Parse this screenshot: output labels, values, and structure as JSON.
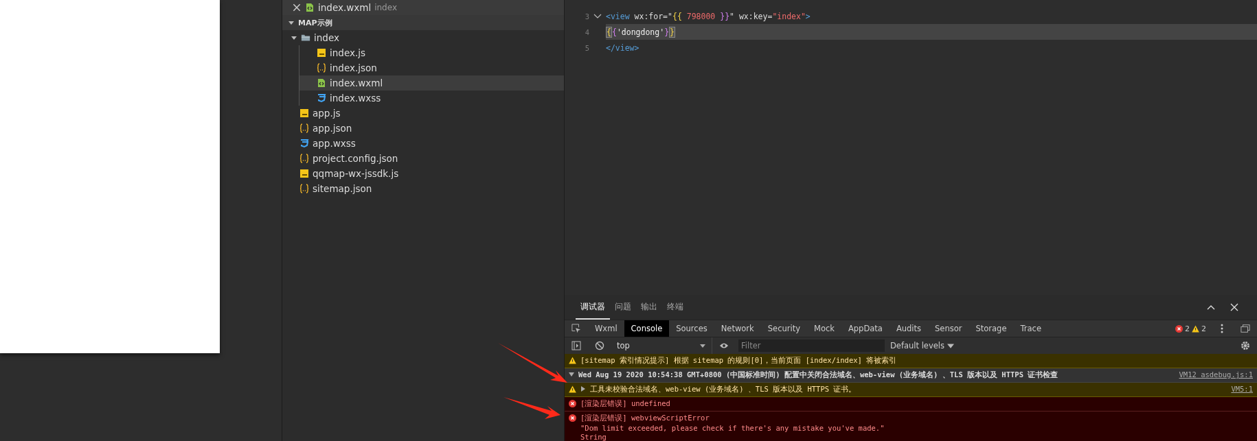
{
  "explorer": {
    "open_editors": [
      {
        "label": "index.wxml",
        "hint": "index",
        "kind": "wxml"
      }
    ],
    "project": {
      "label": "MAP示例",
      "expanded": true
    },
    "tree": [
      {
        "label": "index",
        "kind": "folder",
        "expanded": true,
        "selected": false,
        "children": [
          {
            "label": "index.js",
            "kind": "js",
            "selected": false
          },
          {
            "label": "index.json",
            "kind": "json",
            "selected": false
          },
          {
            "label": "index.wxml",
            "kind": "wxml",
            "selected": true
          },
          {
            "label": "index.wxss",
            "kind": "wxss",
            "selected": false
          }
        ]
      },
      {
        "label": "app.js",
        "kind": "js",
        "selected": false
      },
      {
        "label": "app.json",
        "kind": "json",
        "selected": false
      },
      {
        "label": "app.wxss",
        "kind": "wxss",
        "selected": false
      },
      {
        "label": "project.config.json",
        "kind": "json",
        "selected": false
      },
      {
        "label": "qqmap-wx-jssdk.js",
        "kind": "js",
        "selected": false
      },
      {
        "label": "sitemap.json",
        "kind": "json",
        "selected": false
      }
    ]
  },
  "editor": {
    "lines": [
      {
        "number": "3",
        "foldable": true,
        "current": false,
        "tokens": [
          {
            "text": "<view",
            "kind": "tag"
          },
          {
            "text": " wx:for=",
            "kind": "attr"
          },
          {
            "text": "\"",
            "kind": "attr"
          },
          {
            "text": "{{",
            "kind": "brace1"
          },
          {
            "text": " 798000 ",
            "kind": "number"
          },
          {
            "text": "}}",
            "kind": "brace2"
          },
          {
            "text": "\"",
            "kind": "attr"
          },
          {
            "text": " wx:key=",
            "kind": "attr"
          },
          {
            "text": "\"index\"",
            "kind": "string"
          },
          {
            "text": ">",
            "kind": "tag"
          }
        ]
      },
      {
        "number": "4",
        "foldable": false,
        "current": true,
        "tokens": [
          {
            "text": "{",
            "kind": "match"
          },
          {
            "text": "{",
            "kind": "brace2"
          },
          {
            "text": "'dongdong'",
            "kind": "plain"
          },
          {
            "text": "}",
            "kind": "brace2"
          },
          {
            "text": "}",
            "kind": "match"
          }
        ]
      },
      {
        "number": "5",
        "foldable": false,
        "current": false,
        "tokens": [
          {
            "text": "</view>",
            "kind": "tag"
          }
        ]
      }
    ]
  },
  "debugger": {
    "panel_tabs": [
      {
        "label": "调试器",
        "selected": true
      },
      {
        "label": "问题",
        "selected": false
      },
      {
        "label": "输出",
        "selected": false
      },
      {
        "label": "终端",
        "selected": false
      }
    ],
    "tools": [
      {
        "label": "Wxml",
        "selected": false
      },
      {
        "label": "Console",
        "selected": true
      },
      {
        "label": "Sources",
        "selected": false
      },
      {
        "label": "Network",
        "selected": false
      },
      {
        "label": "Security",
        "selected": false
      },
      {
        "label": "Mock",
        "selected": false
      },
      {
        "label": "AppData",
        "selected": false
      },
      {
        "label": "Audits",
        "selected": false
      },
      {
        "label": "Sensor",
        "selected": false
      },
      {
        "label": "Storage",
        "selected": false
      },
      {
        "label": "Trace",
        "selected": false
      }
    ],
    "error_count": "2",
    "warning_count": "2",
    "context": "top",
    "filter_placeholder": "Filter",
    "levels": "Default levels",
    "messages": [
      {
        "kind": "warning",
        "lines": [
          "[sitemap 索引情况提示] 根据 sitemap 的规则[0]，当前页面 [index/index] 将被索引"
        ]
      },
      {
        "kind": "group",
        "expanded": true,
        "lines": [
          "Wed Aug 19 2020 10:54:38 GMT+0800 (中国标准时间) 配置中关闭合法域名、web-view (业务域名) 、TLS 版本以及 HTTPS 证书检查"
        ],
        "source": "VM12 asdebug.js:1"
      },
      {
        "kind": "warning",
        "expanded": false,
        "lines": [
          "工具未校验合法域名、web-view (业务域名) 、TLS 版本以及 HTTPS 证书。"
        ],
        "source": "VM5:1"
      },
      {
        "kind": "error",
        "lines": [
          "[渲染层错误] undefined"
        ]
      },
      {
        "kind": "error",
        "lines": [
          "[渲染层错误] webviewScriptError",
          "\"Dom limit exceeded, please check if there's any mistake you've made.\"",
          "String"
        ]
      }
    ]
  }
}
